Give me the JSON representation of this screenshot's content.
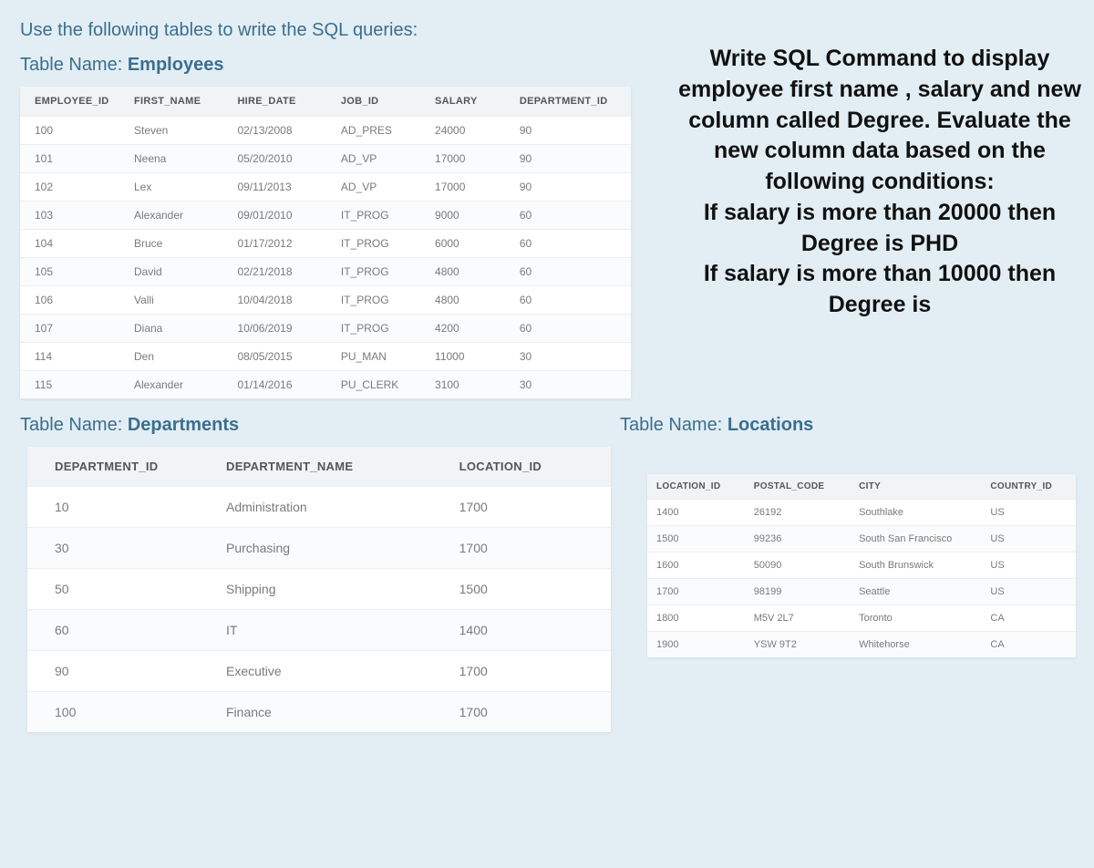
{
  "intro": "Use the following tables to write the SQL queries:",
  "labels": {
    "employees_prefix": "Table Name: ",
    "employees_name": "Employees",
    "departments_prefix": "Table Name: ",
    "departments_name": "Departments",
    "locations_prefix": "Table Name: ",
    "locations_name": "Locations"
  },
  "employees": {
    "headers": [
      "EMPLOYEE_ID",
      "FIRST_NAME",
      "HIRE_DATE",
      "JOB_ID",
      "SALARY",
      "DEPARTMENT_ID"
    ],
    "rows": [
      [
        "100",
        "Steven",
        "02/13/2008",
        "AD_PRES",
        "24000",
        "90"
      ],
      [
        "101",
        "Neena",
        "05/20/2010",
        "AD_VP",
        "17000",
        "90"
      ],
      [
        "102",
        "Lex",
        "09/11/2013",
        "AD_VP",
        "17000",
        "90"
      ],
      [
        "103",
        "Alexander",
        "09/01/2010",
        "IT_PROG",
        "9000",
        "60"
      ],
      [
        "104",
        "Bruce",
        "01/17/2012",
        "IT_PROG",
        "6000",
        "60"
      ],
      [
        "105",
        "David",
        "02/21/2018",
        "IT_PROG",
        "4800",
        "60"
      ],
      [
        "106",
        "Valli",
        "10/04/2018",
        "IT_PROG",
        "4800",
        "60"
      ],
      [
        "107",
        "Diana",
        "10/06/2019",
        "IT_PROG",
        "4200",
        "60"
      ],
      [
        "114",
        "Den",
        "08/05/2015",
        "PU_MAN",
        "11000",
        "30"
      ],
      [
        "115",
        "Alexander",
        "01/14/2016",
        "PU_CLERK",
        "3100",
        "30"
      ]
    ]
  },
  "departments": {
    "headers": [
      "DEPARTMENT_ID",
      "DEPARTMENT_NAME",
      "LOCATION_ID"
    ],
    "rows": [
      [
        "10",
        "Administration",
        "1700"
      ],
      [
        "30",
        "Purchasing",
        "1700"
      ],
      [
        "50",
        "Shipping",
        "1500"
      ],
      [
        "60",
        "IT",
        "1400"
      ],
      [
        "90",
        "Executive",
        "1700"
      ],
      [
        "100",
        "Finance",
        "1700"
      ]
    ]
  },
  "locations": {
    "headers": [
      "LOCATION_ID",
      "POSTAL_CODE",
      "CITY",
      "COUNTRY_ID"
    ],
    "rows": [
      [
        "1400",
        "26192",
        "Southlake",
        "US"
      ],
      [
        "1500",
        "99236",
        "South San Francisco",
        "US"
      ],
      [
        "1600",
        "50090",
        "South Brunswick",
        "US"
      ],
      [
        "1700",
        "98199",
        "Seattle",
        "US"
      ],
      [
        "1800",
        "M5V 2L7",
        "Toronto",
        "CA"
      ],
      [
        "1900",
        "YSW 9T2",
        "Whitehorse",
        "CA"
      ]
    ]
  },
  "question": "Write SQL Command to display employee first name , salary and  new column called Degree. Evaluate the new column data based on the following conditions:\nIf salary is more than 20000 then Degree is PHD\nIf salary is more than 10000 then Degree is"
}
